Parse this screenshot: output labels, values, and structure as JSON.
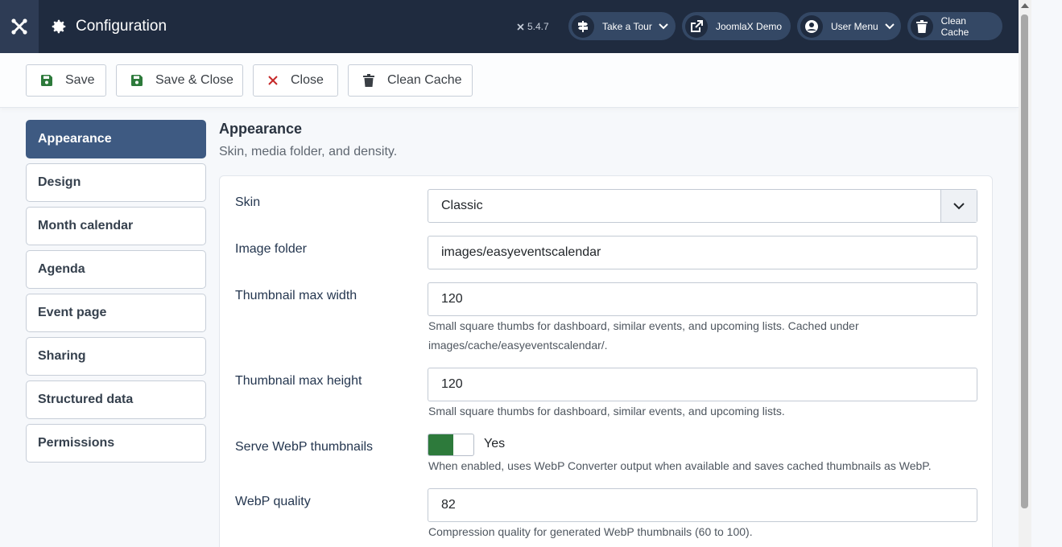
{
  "header": {
    "title": "Configuration",
    "version": "5.4.7",
    "buttons": [
      {
        "label": "Take a Tour",
        "icon": "signpost-icon",
        "has_dropdown": true
      },
      {
        "label": "JoomlaX Demo",
        "icon": "external-link-icon",
        "has_dropdown": false
      },
      {
        "label": "User Menu",
        "icon": "user-icon",
        "has_dropdown": true
      },
      {
        "label": "Clean Cache",
        "icon": "trash-icon",
        "has_dropdown": false
      }
    ]
  },
  "toolbar": {
    "save_label": "Save",
    "save_close_label": "Save & Close",
    "close_label": "Close",
    "clean_cache_label": "Clean Cache"
  },
  "tabs": [
    {
      "label": "Appearance",
      "active": true
    },
    {
      "label": "Design",
      "active": false
    },
    {
      "label": "Month calendar",
      "active": false
    },
    {
      "label": "Agenda",
      "active": false
    },
    {
      "label": "Event page",
      "active": false
    },
    {
      "label": "Sharing",
      "active": false
    },
    {
      "label": "Structured data",
      "active": false
    },
    {
      "label": "Permissions",
      "active": false
    }
  ],
  "section": {
    "title": "Appearance",
    "description": "Skin, media folder, and density."
  },
  "fields": {
    "skin": {
      "label": "Skin",
      "value": "Classic"
    },
    "image_folder": {
      "label": "Image folder",
      "value": "images/easyeventscalendar"
    },
    "thumb_width": {
      "label": "Thumbnail max width",
      "value": "120",
      "help": "Small square thumbs for dashboard, similar events, and upcoming lists. Cached under images/cache/easyeventscalendar/."
    },
    "thumb_height": {
      "label": "Thumbnail max height",
      "value": "120",
      "help": "Small square thumbs for dashboard, similar events, and upcoming lists."
    },
    "webp": {
      "label": "Serve WebP thumbnails",
      "value": "Yes",
      "help": "When enabled, uses WebP Converter output when available and saves cached thumbnails as WebP."
    },
    "webp_quality": {
      "label": "WebP quality",
      "value": "82",
      "help": "Compression quality for generated WebP thumbnails (60 to 100)."
    }
  },
  "colors": {
    "header_bg": "#1f2b3f",
    "active_tab": "#3e5a82",
    "toggle_on": "#2d7a3b",
    "save_icon": "#2d7a3b",
    "close_icon": "#c52828"
  }
}
